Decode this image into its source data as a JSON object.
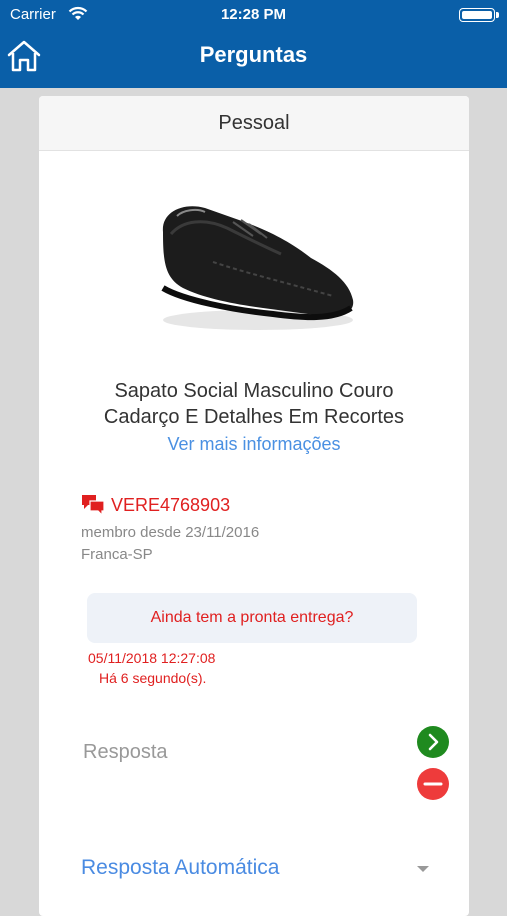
{
  "status_bar": {
    "carrier": "Carrier",
    "time": "12:28 PM"
  },
  "nav": {
    "title": "Perguntas",
    "home_icon": "home-icon"
  },
  "card": {
    "header": "Pessoal",
    "product": {
      "title_line1": "Sapato Social Masculino Couro",
      "title_line2": "Cadarço E Detalhes Em Recortes",
      "more_info": "Ver mais informações"
    },
    "user": {
      "username": "VERE4768903",
      "member_since": "membro desde 23/11/2016",
      "location": "Franca-SP"
    },
    "question": {
      "text": "Ainda tem a pronta entrega?",
      "date": "05/11/2018 12:27:08",
      "ago": "Há 6 segundo(s)."
    },
    "answer": {
      "placeholder": "Resposta",
      "value": ""
    },
    "auto_answer": {
      "label": "Resposta Automática"
    }
  },
  "colors": {
    "nav_bg": "#0a5fa8",
    "accent_red": "#e02020",
    "link_blue": "#4a90e2",
    "send_green": "#1f8a1f",
    "cancel_red": "#ee3b3b"
  }
}
